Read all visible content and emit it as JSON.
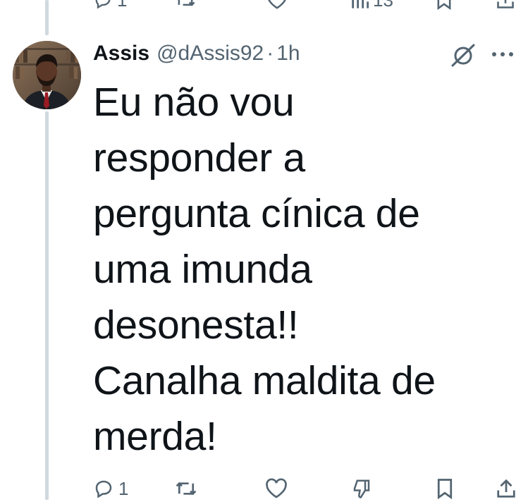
{
  "previous_tweet": {
    "actions": {
      "reply_count": "1",
      "views_count": "13"
    }
  },
  "tweet": {
    "author": {
      "display_name": "Assis",
      "handle": "@dAssis92",
      "separator": "·",
      "time": "1h"
    },
    "text_lines": [
      "Eu não vou",
      "responder a",
      "pergunta cínica de",
      "uma imunda",
      "desonesta!!",
      "Canalha maldita de",
      "merda!"
    ],
    "actions": {
      "reply_count": "1"
    },
    "icons": {
      "grok": "grok-icon",
      "more": "more-horizontal-icon",
      "reply": "reply-icon",
      "retweet": "retweet-icon",
      "like": "heart-icon",
      "downvote": "downvote-icon",
      "bookmark": "bookmark-icon",
      "share": "share-icon"
    }
  },
  "colors": {
    "text_primary": "#0f1419",
    "text_secondary": "#536471",
    "thread_line": "#cfd9de",
    "background": "#ffffff"
  }
}
